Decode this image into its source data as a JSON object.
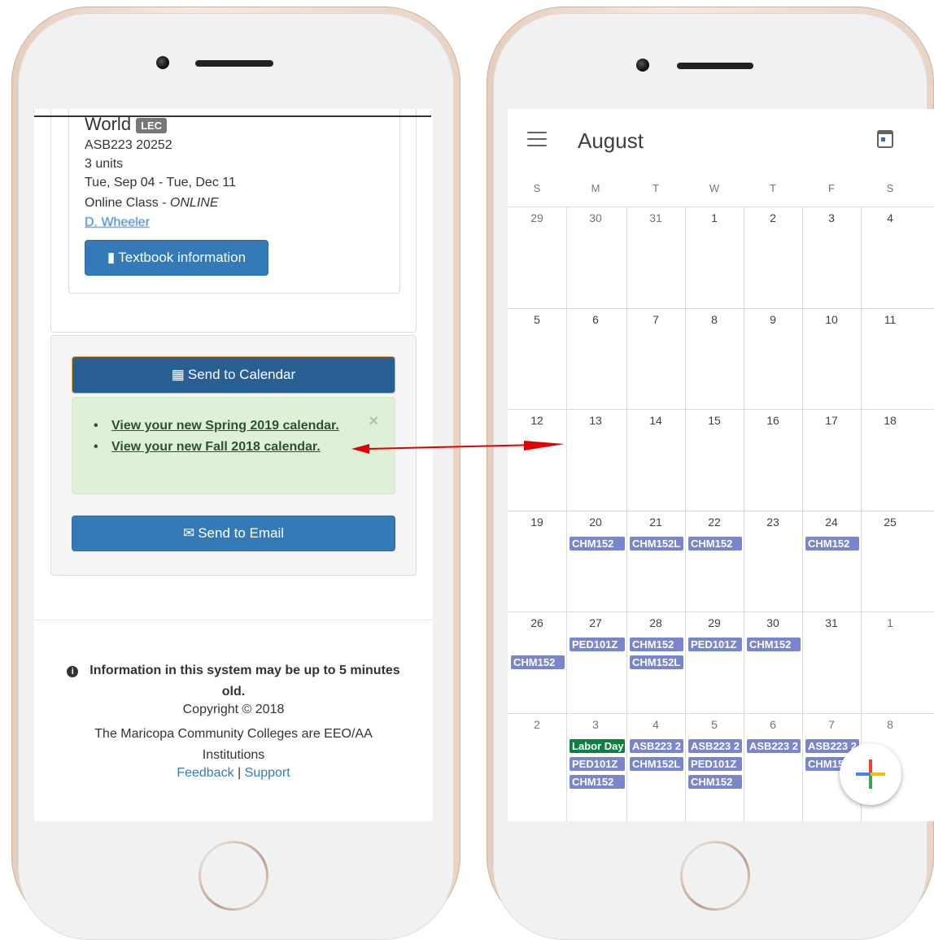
{
  "left_screen": {
    "course_title": "World",
    "course_badge": "LEC",
    "course_code": "ASB223 20252",
    "units": "3 units",
    "dates": "Tue, Sep 04 - Tue, Dec 11",
    "mode_label": "Online Class - ",
    "mode_value": "ONLINE",
    "instructor": "D. Wheeler",
    "textbook_button": "Textbook information",
    "send_calendar_button": "Send to Calendar",
    "alert_links": [
      "View your new Spring 2019 calendar.",
      "View your new Fall 2018 calendar."
    ],
    "alert_close": "×",
    "send_email_button": "Send to Email",
    "footer": {
      "info": "Information in this system may be up to 5 minutes old.",
      "copyright": "Copyright © 2018",
      "eeo": "The Maricopa Community Colleges are EEO/AA Institutions",
      "feedback": "Feedback",
      "separator": "|",
      "support": "Support"
    }
  },
  "calendar": {
    "month": "August",
    "weekdays": [
      "S",
      "M",
      "T",
      "W",
      "T",
      "F",
      "S"
    ],
    "weeks": [
      [
        "29",
        "30",
        "31",
        "1",
        "2",
        "3",
        "4"
      ],
      [
        "5",
        "6",
        "7",
        "8",
        "9",
        "10",
        "11"
      ],
      [
        "12",
        "13",
        "14",
        "15",
        "16",
        "17",
        "18"
      ],
      [
        "19",
        "20",
        "21",
        "22",
        "23",
        "24",
        "25"
      ],
      [
        "26",
        "27",
        "28",
        "29",
        "30",
        "31",
        "1"
      ],
      [
        "2",
        "3",
        "4",
        "5",
        "6",
        "7",
        "8"
      ]
    ],
    "events": [
      {
        "week": 3,
        "day": 1,
        "row": 0,
        "label": "CHM152",
        "color": "#7986cb"
      },
      {
        "week": 3,
        "day": 2,
        "row": 0,
        "label": "CHM152L",
        "color": "#7986cb"
      },
      {
        "week": 3,
        "day": 3,
        "row": 0,
        "label": "CHM152",
        "color": "#7986cb"
      },
      {
        "week": 3,
        "day": 5,
        "row": 0,
        "label": "CHM152",
        "color": "#7986cb"
      },
      {
        "week": 4,
        "day": 1,
        "row": 0,
        "label": "PED101Z",
        "color": "#7986cb"
      },
      {
        "week": 4,
        "day": 2,
        "row": 0,
        "label": "CHM152",
        "color": "#7986cb"
      },
      {
        "week": 4,
        "day": 3,
        "row": 0,
        "label": "PED101Z",
        "color": "#7986cb"
      },
      {
        "week": 4,
        "day": 4,
        "row": 0,
        "label": "CHM152",
        "color": "#7986cb"
      },
      {
        "week": 4,
        "day": 0,
        "row": 1,
        "label": "CHM152",
        "color": "#7986cb"
      },
      {
        "week": 4,
        "day": 2,
        "row": 1,
        "label": "CHM152L",
        "color": "#7986cb"
      },
      {
        "week": 5,
        "day": 1,
        "row": 0,
        "label": "Labor Day",
        "color": "#0b8043"
      },
      {
        "week": 5,
        "day": 2,
        "row": 0,
        "label": "ASB223 2",
        "color": "#7986cb"
      },
      {
        "week": 5,
        "day": 3,
        "row": 0,
        "label": "ASB223 2",
        "color": "#7986cb"
      },
      {
        "week": 5,
        "day": 4,
        "row": 0,
        "label": "ASB223 2",
        "color": "#7986cb"
      },
      {
        "week": 5,
        "day": 5,
        "row": 0,
        "label": "ASB223 2",
        "color": "#7986cb"
      },
      {
        "week": 5,
        "day": 1,
        "row": 1,
        "label": "PED101Z",
        "color": "#7986cb"
      },
      {
        "week": 5,
        "day": 2,
        "row": 1,
        "label": "CHM152L",
        "color": "#7986cb"
      },
      {
        "week": 5,
        "day": 3,
        "row": 1,
        "label": "PED101Z",
        "color": "#7986cb"
      },
      {
        "week": 5,
        "day": 5,
        "row": 1,
        "label": "CHM152",
        "color": "#7986cb"
      },
      {
        "week": 5,
        "day": 1,
        "row": 2,
        "label": "CHM152",
        "color": "#7986cb"
      },
      {
        "week": 5,
        "day": 3,
        "row": 2,
        "label": "CHM152",
        "color": "#7986cb"
      }
    ],
    "fab_icon": "plus-icon"
  },
  "colors": {
    "primary_button": "#337ab7",
    "calendar_button": "#2a5f94",
    "alert_bg": "#dff0d8",
    "event": "#7986cb",
    "holiday": "#0b8043",
    "arrow": "#e00000"
  }
}
